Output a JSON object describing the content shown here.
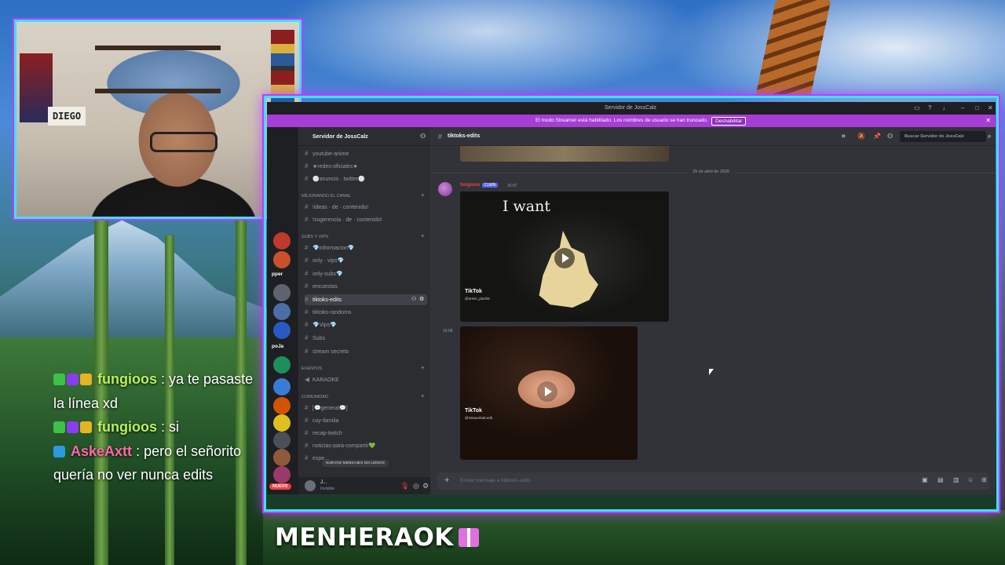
{
  "stream": {
    "webcam_nameplate": "DIEGO",
    "streamer_nick": "MENHERAOK"
  },
  "chat": [
    {
      "user": "fungioos",
      "text": ": ya te pasaste la línea xd"
    },
    {
      "user": "fungioos",
      "text": ": si"
    },
    {
      "user": "AskeAxtt",
      "text": ": pero el señorito quería no ver nunca edits"
    }
  ],
  "discord": {
    "window_title": "Servidor de JossCalz",
    "streamer_banner": {
      "message": "El modo Streamer está habilitado. Los nombres de usuario se han truncado.",
      "button": "Deshabilitar"
    },
    "server_name": "Servidor de JossCalz",
    "server_rail": {
      "labels": [
        "pper",
        "poJa"
      ],
      "badge": "NUEVO"
    },
    "channels": {
      "top": [
        {
          "name": "youtube-anime",
          "active": false
        },
        {
          "name": "★redes-oficiales★",
          "active": false
        },
        {
          "name": "⚪anuncio · twitter⚪",
          "active": false
        }
      ],
      "categories": [
        {
          "label": "MEJORANDO EL CANAL",
          "items": [
            "!ideas · de · contenido!",
            "!sugerencia · de · contenido!"
          ]
        },
        {
          "label": "Subs y VIPS",
          "items": [
            "💎informacion💎",
            "only · vips💎",
            "only-subs💎",
            "encuestas",
            "tiktoks-edits",
            "tiktoks-randoms",
            "💎Vips💎",
            "Subs",
            "stream secreto"
          ]
        },
        {
          "label": "EVENTOS",
          "items": [
            "KARAOKE"
          ]
        },
        {
          "label": "Comunidad",
          "items": [
            "[💬general💬]",
            "cuy-familia",
            "recap-twitch",
            "noticias-para-compartir💚",
            "espe..."
          ]
        }
      ],
      "active_channel": "tiktoks-edits",
      "unread_pill": "NUEVOS MENSAJES NO LEÍDOS"
    },
    "user_panel": {
      "name": "J...",
      "status": "Invisible"
    },
    "main": {
      "channel_name": "tiktoks-edits",
      "search_placeholder": "Buscar Servidor de JossCalz",
      "date_divider": "29 de abril de 2026",
      "message": {
        "author": "fungioos",
        "tag": "CLWN",
        "time": "16:07"
      },
      "video1": {
        "overlay_text": "I want",
        "tiktok_label": "TikTok",
        "tiktok_user": "@armin_plush5"
      },
      "video2": {
        "time": "16:08",
        "tiktok_label": "TikTok",
        "tiktok_user": "@miiauerkatt.edit"
      },
      "composer_placeholder": "Enviar mensaje a #tiktoks-edits"
    }
  }
}
